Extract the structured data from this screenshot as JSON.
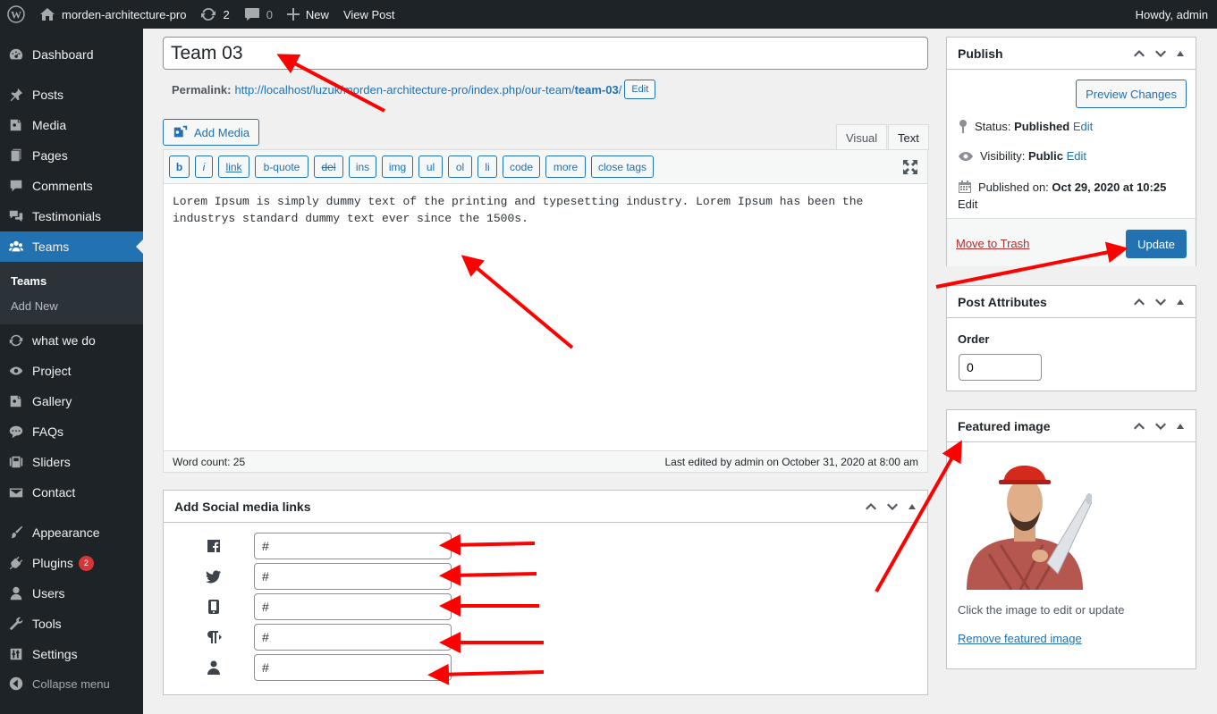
{
  "adminbar": {
    "site_name": "morden-architecture-pro",
    "updates_count": "2",
    "comments_count": "0",
    "new_label": "New",
    "view_post_label": "View Post",
    "howdy": "Howdy, admin"
  },
  "sidebar": {
    "items": [
      {
        "label": "Dashboard",
        "icon": "dashboard-icon"
      },
      {
        "label": "Posts",
        "icon": "pin-icon"
      },
      {
        "label": "Media",
        "icon": "media-icon"
      },
      {
        "label": "Pages",
        "icon": "page-icon"
      },
      {
        "label": "Comments",
        "icon": "comment-icon"
      },
      {
        "label": "Testimonials",
        "icon": "testimonial-icon"
      },
      {
        "label": "Teams",
        "icon": "groups-icon"
      },
      {
        "label": "what we do",
        "icon": "update-icon"
      },
      {
        "label": "Project",
        "icon": "visibility-icon"
      },
      {
        "label": "Gallery",
        "icon": "gallery-icon"
      },
      {
        "label": "FAQs",
        "icon": "speech-icon"
      },
      {
        "label": "Sliders",
        "icon": "slides-icon"
      },
      {
        "label": "Contact",
        "icon": "email-icon"
      },
      {
        "label": "Appearance",
        "icon": "brush-icon"
      },
      {
        "label": "Plugins",
        "icon": "plugin-icon",
        "badge": "2"
      },
      {
        "label": "Users",
        "icon": "user-icon"
      },
      {
        "label": "Tools",
        "icon": "wrench-icon"
      },
      {
        "label": "Settings",
        "icon": "settings-icon"
      }
    ],
    "submenu": {
      "current": "Teams",
      "add_new": "Add New"
    },
    "collapse_label": "Collapse menu"
  },
  "editor": {
    "title_value": "Team 03",
    "permalink_label": "Permalink:",
    "permalink_url_prefix": "http://localhost/luzuk/morden-architecture-pro/index.php/our-team/",
    "permalink_slug": "team-03",
    "permalink_suffix": "/",
    "edit_label": "Edit",
    "add_media_label": "Add Media",
    "tab_visual": "Visual",
    "tab_text": "Text",
    "qt_buttons": [
      "b",
      "i",
      "link",
      "b-quote",
      "del",
      "ins",
      "img",
      "ul",
      "ol",
      "li",
      "code",
      "more",
      "close tags"
    ],
    "content": "Lorem Ipsum is simply dummy text of the printing and typesetting industry. Lorem Ipsum has been the industrys standard dummy text ever since the 1500s.",
    "word_count": "Word count: 25",
    "last_edited": "Last edited by admin on October 31, 2020 at 8:00 am"
  },
  "social": {
    "title": "Add Social media links",
    "fields": [
      {
        "icon": "facebook-icon",
        "value": "#"
      },
      {
        "icon": "twitter-icon",
        "value": "#"
      },
      {
        "icon": "phone-icon",
        "value": "#"
      },
      {
        "icon": "paragraph-icon",
        "value": "#"
      },
      {
        "icon": "person-icon",
        "value": "#"
      }
    ]
  },
  "publish": {
    "title": "Publish",
    "preview_label": "Preview Changes",
    "status_label": "Status:",
    "status_value": "Published",
    "visibility_label": "Visibility:",
    "visibility_value": "Public",
    "published_label": "Published on:",
    "published_value": "Oct 29, 2020 at 10:25",
    "edit_label": "Edit",
    "trash_label": "Move to Trash",
    "update_label": "Update"
  },
  "attributes": {
    "title": "Post Attributes",
    "order_label": "Order",
    "order_value": "0"
  },
  "featured": {
    "title": "Featured image",
    "hint": "Click the image to edit or update",
    "remove_label": "Remove featured image"
  },
  "colors": {
    "admin_bg": "#1d2327",
    "accent": "#2271b1",
    "annotation_arrow": "#ff0000"
  }
}
